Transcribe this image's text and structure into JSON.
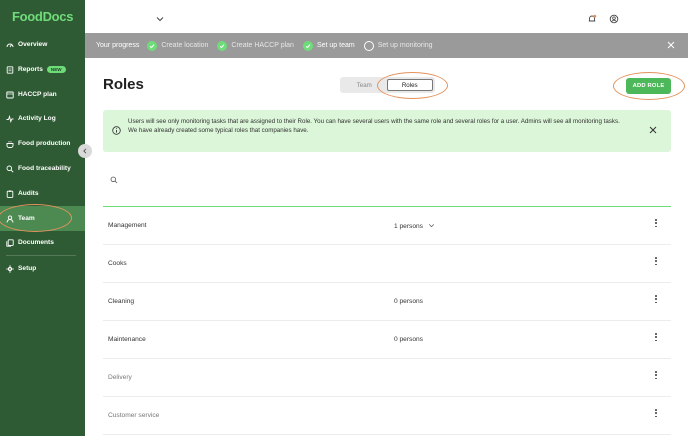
{
  "app": {
    "logo": "FoodDocs"
  },
  "sidebar": {
    "items": [
      {
        "label": "Overview",
        "icon": "overview-icon"
      },
      {
        "label": "Reports",
        "icon": "reports-icon",
        "badge": "NEW"
      },
      {
        "label": "HACCP plan",
        "icon": "haccp-icon"
      },
      {
        "label": "Activity Log",
        "icon": "activity-icon"
      },
      {
        "label": "Food production",
        "icon": "food-production-icon"
      },
      {
        "label": "Food traceability",
        "icon": "search-icon"
      },
      {
        "label": "Audits",
        "icon": "audits-icon"
      },
      {
        "label": "Team",
        "icon": "user-icon",
        "active": true
      },
      {
        "label": "Documents",
        "icon": "documents-icon"
      },
      {
        "label": "Setup",
        "icon": "gear-icon"
      }
    ]
  },
  "progress": {
    "title": "Your progress",
    "steps": [
      {
        "label": "Create location",
        "state": "done"
      },
      {
        "label": "Create HACCP plan",
        "state": "done"
      },
      {
        "label": "Set up team",
        "state": "current"
      },
      {
        "label": "Set up monitoring",
        "state": "todo"
      }
    ]
  },
  "main": {
    "title": "Roles",
    "tabs": [
      {
        "label": "Team"
      },
      {
        "label": "Roles",
        "active": true
      }
    ],
    "add_button": "ADD ROLE",
    "info_lines": [
      "Users will see only monitoring tasks that are assigned to their Role. You can have several users with the same role and several roles for a user. Admins will see all monitoring tasks.",
      "We have already created some typical roles that companies have."
    ],
    "search_placeholder": ""
  },
  "roles": [
    {
      "name": "Management",
      "count": "1 persons",
      "expandable": true
    },
    {
      "name": "Cooks",
      "count": ""
    },
    {
      "name": "Cleaning",
      "count": "0 persons"
    },
    {
      "name": "Maintenance",
      "count": "0 persons"
    },
    {
      "name": "Delivery",
      "count": "",
      "dim": true
    },
    {
      "name": "Customer service",
      "count": "",
      "dim": true
    }
  ],
  "colors": {
    "sidebar": "#2f5b34",
    "accent": "#6fdc7a",
    "button": "#4cb85a",
    "info_bg": "#dbf6d8",
    "highlight_ring": "#e3935e"
  }
}
